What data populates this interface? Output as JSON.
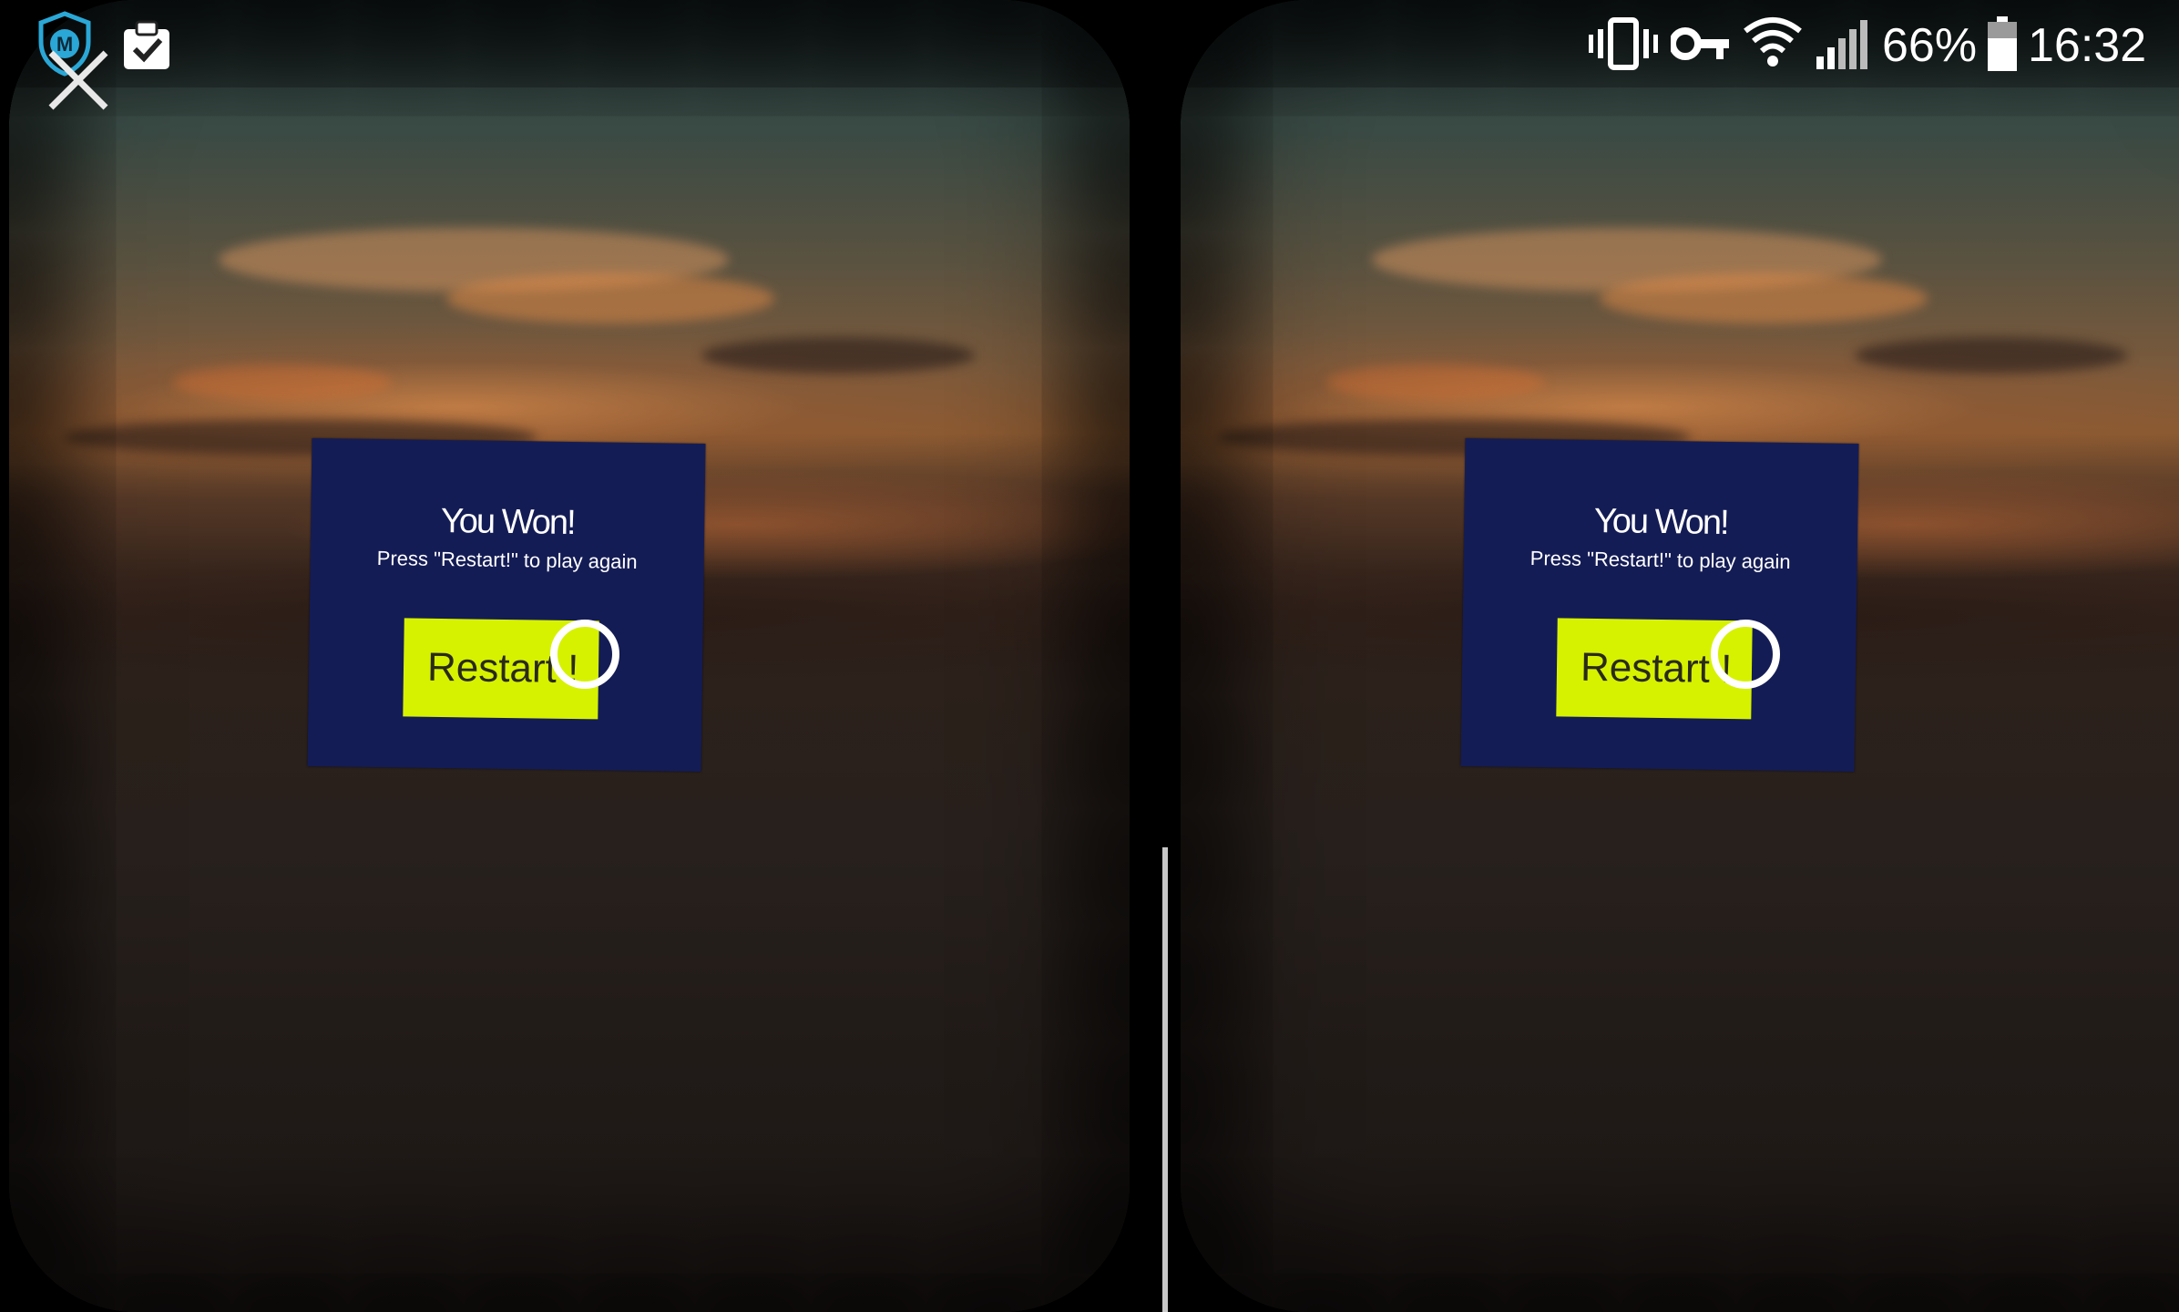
{
  "status_bar": {
    "battery_percent": "66%",
    "time": "16:32",
    "icons": [
      "shield-m-icon",
      "clipboard-check-icon",
      "vibrate-icon",
      "vpn-key-icon",
      "wifi-icon",
      "signal-icon",
      "battery-icon"
    ]
  },
  "close_button": {
    "icon": "close-icon"
  },
  "dialog": {
    "title": "You Won!",
    "subtitle": "Press \"Restart!\" to play  again",
    "button_label": "Restart !"
  },
  "colors": {
    "panel": "#141c55",
    "button": "#d6f200",
    "reticle": "#ffffff"
  }
}
